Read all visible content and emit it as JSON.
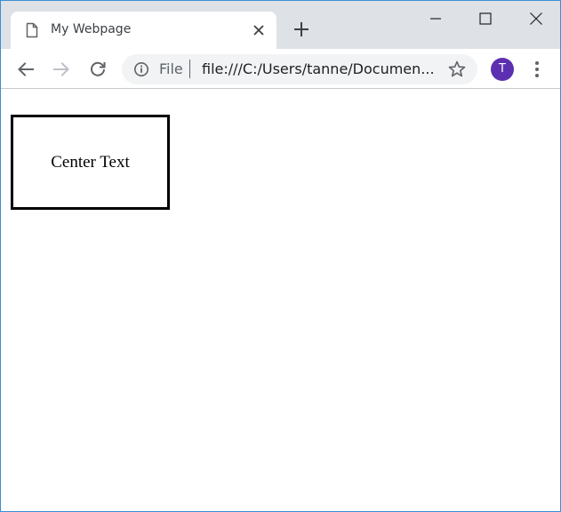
{
  "browser": {
    "tab": {
      "title": "My Webpage"
    },
    "omnibox": {
      "scheme_label": "File",
      "url": "file:///C:/Users/tanne/Documen..."
    },
    "profile": {
      "initial": "T",
      "color": "#5c2fb0"
    }
  },
  "page": {
    "box_text": "Center Text"
  },
  "icons": {
    "tab_favicon": "document-icon",
    "tab_close": "close-icon",
    "new_tab": "plus-icon",
    "minimize": "minimize-icon",
    "maximize": "maximize-icon",
    "close": "window-close-icon",
    "back": "back-arrow-icon",
    "forward": "forward-arrow-icon",
    "reload": "reload-icon",
    "info": "info-icon",
    "bookmark": "star-icon",
    "menu": "kebab-menu-icon"
  },
  "colors": {
    "tabstrip_bg": "#dee1e6",
    "omnibox_bg": "#f1f3f4",
    "window_border": "#3a8fd6"
  }
}
